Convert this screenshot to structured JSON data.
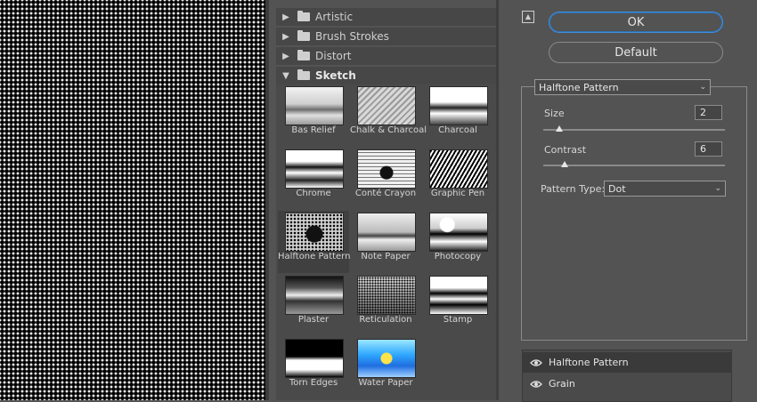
{
  "categories": [
    {
      "label": "Artistic",
      "expanded": false
    },
    {
      "label": "Brush Strokes",
      "expanded": false
    },
    {
      "label": "Distort",
      "expanded": false
    },
    {
      "label": "Sketch",
      "expanded": true
    }
  ],
  "filters": [
    {
      "label": "Bas Relief",
      "selected": false
    },
    {
      "label": "Chalk & Charcoal",
      "selected": false
    },
    {
      "label": "Charcoal",
      "selected": false
    },
    {
      "label": "Chrome",
      "selected": false
    },
    {
      "label": "Conté Crayon",
      "selected": false
    },
    {
      "label": "Graphic Pen",
      "selected": false
    },
    {
      "label": "Halftone Pattern",
      "selected": true
    },
    {
      "label": "Note Paper",
      "selected": false
    },
    {
      "label": "Photocopy",
      "selected": false
    },
    {
      "label": "Plaster",
      "selected": false
    },
    {
      "label": "Reticulation",
      "selected": false
    },
    {
      "label": "Stamp",
      "selected": false
    },
    {
      "label": "Torn Edges",
      "selected": false
    },
    {
      "label": "Water Paper",
      "selected": false
    }
  ],
  "buttons": {
    "ok": "OK",
    "default": "Default"
  },
  "settings": {
    "filter_name": "Halftone Pattern",
    "size": {
      "label": "Size",
      "value": "2",
      "fraction": 0.09
    },
    "contrast": {
      "label": "Contrast",
      "value": "6",
      "fraction": 0.12
    },
    "pattern_type": {
      "label": "Pattern Type:",
      "value": "Dot"
    }
  },
  "layers": [
    {
      "label": "Halftone Pattern",
      "active": true
    },
    {
      "label": "Grain",
      "active": false
    }
  ],
  "colors": {
    "accent": "#3c8fe0",
    "panel": "#535353"
  }
}
